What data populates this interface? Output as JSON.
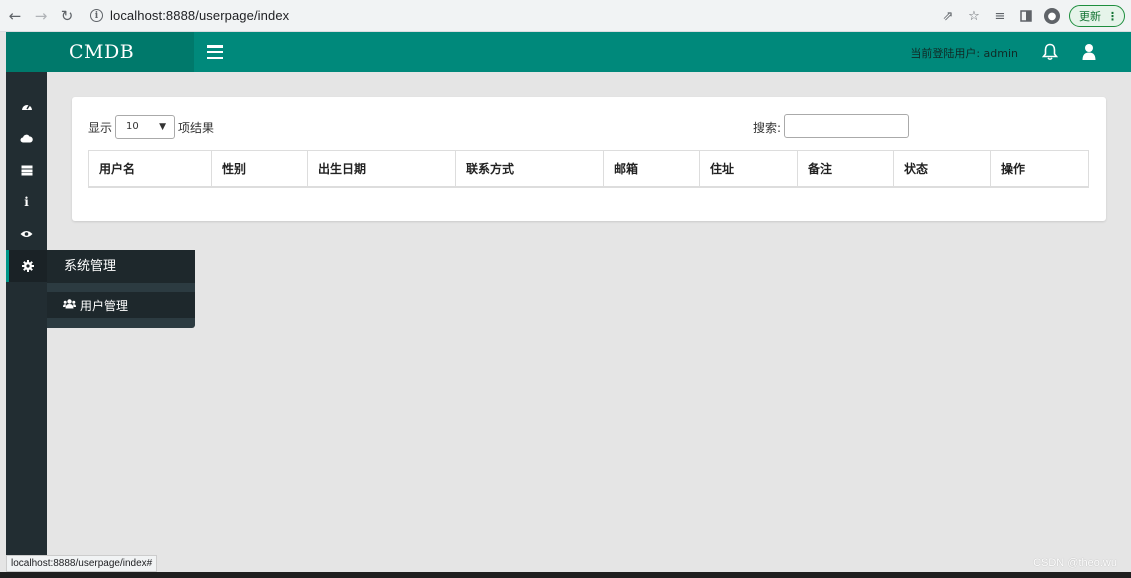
{
  "browser": {
    "url": "localhost:8888/userpage/index",
    "update_label": "更新",
    "status_url": "localhost:8888/userpage/index#"
  },
  "header": {
    "logo": "CMDB",
    "current_user_label": "当前登陆用户: admin",
    "accent_color": "#00897b"
  },
  "sidebar": {
    "icons": [
      "dashboard-icon",
      "cloud-icon",
      "server-icon",
      "info-icon",
      "eye-icon",
      "gear-icon"
    ],
    "flyout": {
      "title": "系统管理",
      "items": [
        {
          "label": "用户管理",
          "icon": "users-icon"
        }
      ]
    }
  },
  "table_controls": {
    "show_label": "显示",
    "page_length": "10",
    "after_label": "项结果",
    "search_label": "搜索:",
    "search_value": ""
  },
  "table": {
    "columns": [
      "用户名",
      "性别",
      "出生日期",
      "联系方式",
      "邮箱",
      "住址",
      "备注",
      "状态",
      "操作"
    ]
  },
  "watermark": "CSDN @theo.wu"
}
